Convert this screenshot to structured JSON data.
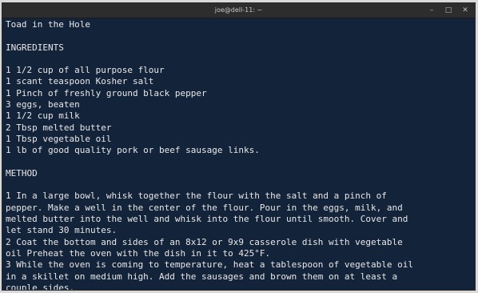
{
  "window": {
    "title": "joe@dell-11: ~",
    "minimize_icon": "minimize-icon",
    "maximize_icon": "maximize-icon",
    "close_icon": "close-icon"
  },
  "terminal": {
    "text": "Toad in the Hole\n\nINGREDIENTS\n\n1 1/2 cup of all purpose flour\n1 scant teaspoon Kosher salt\n1 Pinch of freshly ground black pepper\n3 eggs, beaten\n1 1/2 cup milk\n2 Tbsp melted butter\n1 Tbsp vegetable oil\n1 lb of good quality pork or beef sausage links.\n\nMETHOD\n\n1 In a large bowl, whisk together the flour with the salt and a pinch of\npepper. Make a well in the center of the flour. Pour in the eggs, milk, and\nmelted butter into the well and whisk into the flour until smooth. Cover and\nlet stand 30 minutes.\n2 Coat the bottom and sides of an 8x12 or 9x9 casserole dish with vegetable\noil Preheat the oven with the dish in it to 425°F.\n3 While the oven is coming to temperature, heat a tablespoon of vegetable oil\nin a skillet on medium high. Add the sausages and brown them on at least a\ncouple sides."
  }
}
